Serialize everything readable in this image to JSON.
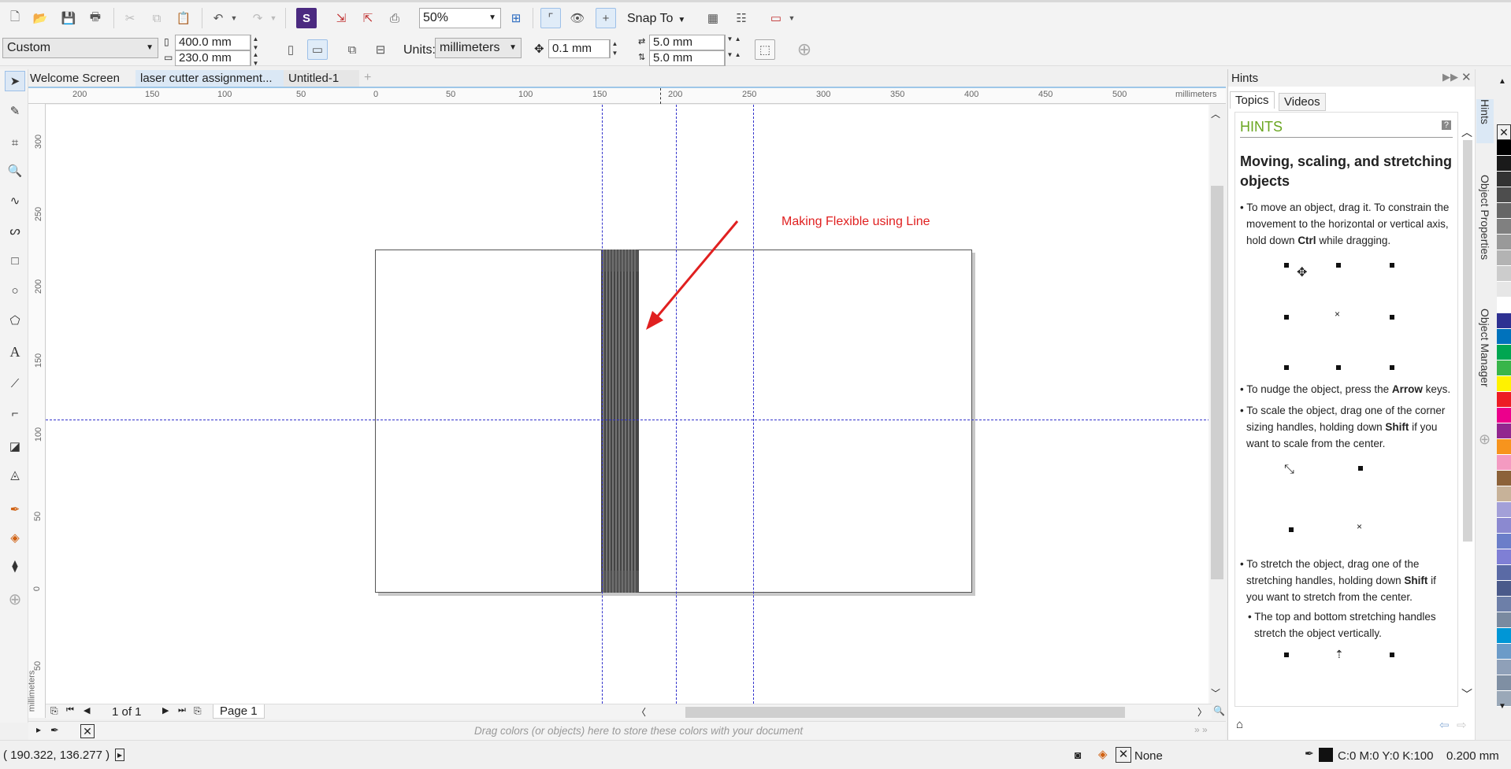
{
  "toolbar": {
    "zoom": "50%",
    "snap_to": "Snap To"
  },
  "property_bar": {
    "page_preset": "Custom",
    "width": "400.0 mm",
    "height": "230.0 mm",
    "units_label": "Units:",
    "units": "millimeters",
    "nudge": "0.1 mm",
    "dup_x": "5.0 mm",
    "dup_y": "5.0 mm"
  },
  "tabs": [
    "Welcome Screen",
    "laser cutter assignment...",
    "Untitled-1"
  ],
  "ruler": {
    "h_labels": [
      "200",
      "150",
      "100",
      "50",
      "0",
      "50",
      "100",
      "150",
      "200",
      "250",
      "300",
      "350",
      "400",
      "450",
      "500"
    ],
    "h_unit": "millimeters",
    "v_labels": [
      "300",
      "250",
      "200",
      "150",
      "100",
      "50",
      "0",
      "50"
    ],
    "v_unit": "millimeters"
  },
  "canvas": {
    "annotation": "Making Flexible using Line",
    "annotation_color": "#e02020"
  },
  "page_nav": {
    "count": "1 of 1",
    "page_tab": "Page 1"
  },
  "palette_hint": "Drag colors (or objects) here to store these colors with your document",
  "status": {
    "coords": "( 190.322, 136.277 )",
    "fill": "None",
    "outline_color": "C:0 M:0 Y:0 K:100",
    "outline_width": "0.200 mm"
  },
  "hints_panel": {
    "title": "Hints",
    "tab_topics": "Topics",
    "tab_videos": "Videos",
    "heading": "HINTS",
    "subheading": "Moving, scaling, and stretching objects",
    "p1_a": "To move an object, drag it. To constrain the movement to the horizontal or vertical axis, hold down ",
    "p1_key": "Ctrl",
    "p1_b": " while dragging.",
    "p2_a": "To nudge the object, press the ",
    "p2_key": "Arrow",
    "p2_b": " keys.",
    "p3_a": "To scale the object, drag one of the corner sizing handles, holding down ",
    "p3_key": "Shift",
    "p3_b": " if you want to scale from the center.",
    "p4_a": "To stretch the object, drag one of the stretching handles, holding down ",
    "p4_key": "Shift",
    "p4_b": " if you want to stretch from the center.",
    "p5": "The top and bottom stretching handles stretch the object vertically."
  },
  "side_tabs": [
    "Hints",
    "Object Properties",
    "Object Manager"
  ],
  "palette_colors": [
    "#000000",
    "#1a1a1a",
    "#333333",
    "#4d4d4d",
    "#666666",
    "#808080",
    "#999999",
    "#b3b3b3",
    "#cccccc",
    "#e6e6e6",
    "#ffffff",
    "#2e3192",
    "#0072bc",
    "#00a651",
    "#39b54a",
    "#fff200",
    "#ed1c24",
    "#ec008c",
    "#92278f",
    "#f7941d",
    "#f49ac1",
    "#8c6239",
    "#c7b299",
    "#a3a0d8",
    "#8b89d0",
    "#6b7ec9",
    "#7f7fd5",
    "#5a6aa5",
    "#4a5a8a",
    "#6d7fa8",
    "#7a8aa0",
    "#0096d6",
    "#6b9bc8",
    "#8fa0b8",
    "#7f8fa3",
    "#9aa8b8"
  ]
}
